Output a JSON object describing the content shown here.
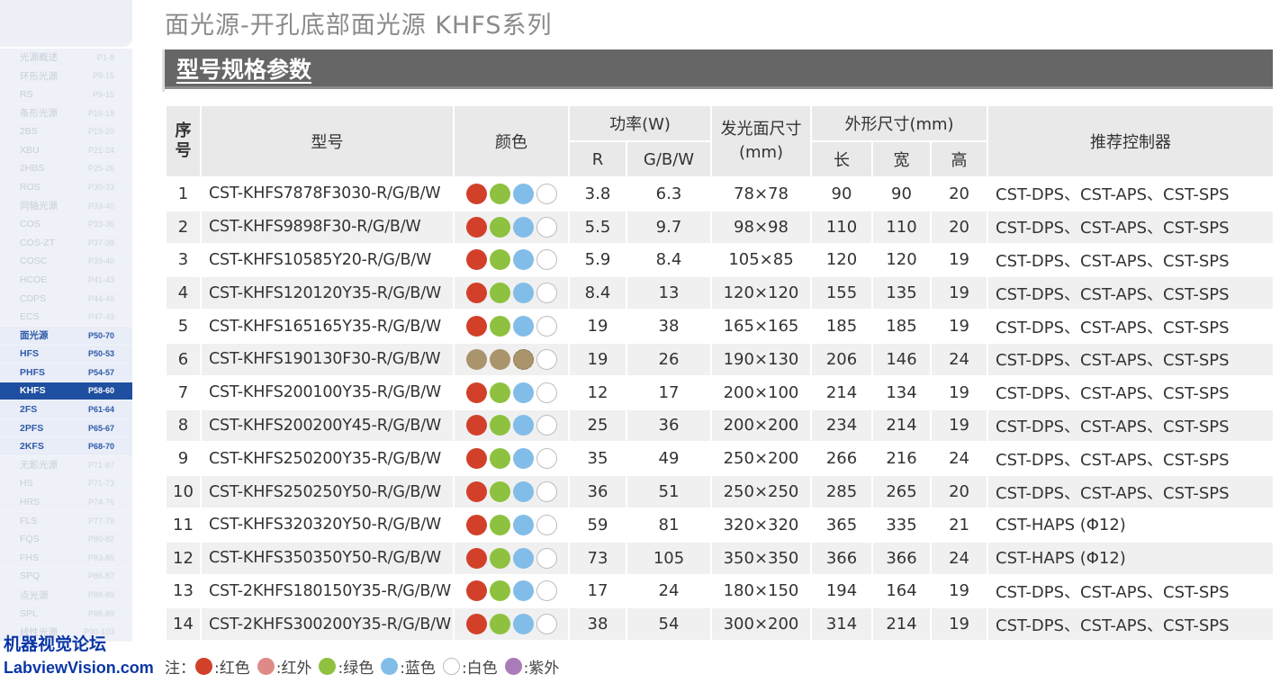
{
  "sidebar": {
    "items": [
      {
        "label": "光源概述",
        "page": "P1-8",
        "state": "faded"
      },
      {
        "label": "环形光源",
        "page": "P9-15",
        "state": "faded"
      },
      {
        "label": "RS",
        "page": "P9-15",
        "state": "faded"
      },
      {
        "label": "条形光源",
        "page": "P16-18",
        "state": "faded"
      },
      {
        "label": "2BS",
        "page": "P19-20",
        "state": "faded"
      },
      {
        "label": "XBU",
        "page": "P21-24",
        "state": "faded"
      },
      {
        "label": "2HBS",
        "page": "P25-26",
        "state": "faded"
      },
      {
        "label": "ROS",
        "page": "P30-33",
        "state": "faded"
      },
      {
        "label": "同轴光源",
        "page": "P33-40",
        "state": "faded"
      },
      {
        "label": "COS",
        "page": "P33-36",
        "state": "faded"
      },
      {
        "label": "COS-ZT",
        "page": "P37-38",
        "state": "faded"
      },
      {
        "label": "COSC",
        "page": "P39-40",
        "state": "faded"
      },
      {
        "label": "HCOE",
        "page": "P41-43",
        "state": "faded"
      },
      {
        "label": "CDPS",
        "page": "P44-46",
        "state": "faded"
      },
      {
        "label": "ECS",
        "page": "P47-49",
        "state": "faded"
      },
      {
        "label": "面光源",
        "page": "P50-70",
        "state": "highlight"
      },
      {
        "label": "HFS",
        "page": "P50-53",
        "state": "highlight"
      },
      {
        "label": "PHFS",
        "page": "P54-57",
        "state": "highlight"
      },
      {
        "label": "KHFS",
        "page": "P58-60",
        "state": "active"
      },
      {
        "label": "2FS",
        "page": "P61-64",
        "state": "highlight"
      },
      {
        "label": "2PFS",
        "page": "P65-67",
        "state": "highlight"
      },
      {
        "label": "2KFS",
        "page": "P68-70",
        "state": "highlight"
      },
      {
        "label": "无影光源",
        "page": "P71-87",
        "state": "faded"
      },
      {
        "label": "HS",
        "page": "P71-73",
        "state": "faded"
      },
      {
        "label": "HRS",
        "page": "P74-76",
        "state": "faded"
      },
      {
        "label": "FLS",
        "page": "P77-79",
        "state": "faded"
      },
      {
        "label": "FQS",
        "page": "P80-82",
        "state": "faded"
      },
      {
        "label": "FHS",
        "page": "P83-85",
        "state": "faded"
      },
      {
        "label": "SPQ",
        "page": "P86-87",
        "state": "faded"
      },
      {
        "label": "点光源",
        "page": "P88-89",
        "state": "faded"
      },
      {
        "label": "SPL",
        "page": "P88-89",
        "state": "faded"
      },
      {
        "label": "线性光源",
        "page": "P90-103",
        "state": "faded"
      }
    ]
  },
  "watermark": {
    "line1": "机器视觉论坛",
    "line2": "LabviewVision.com"
  },
  "page_title": "面光源-开孔底部面光源 KHFS系列",
  "section_title": "型号规格参数",
  "table": {
    "headers": {
      "index": "序号",
      "model": "型号",
      "color": "颜色",
      "power": "功率(W)",
      "power_r": "R",
      "power_gbw": "G/B/W",
      "emit_size": "发光面尺寸(mm)",
      "outline": "外形尺寸(mm)",
      "length": "长",
      "width": "宽",
      "height": "高",
      "controller": "推荐控制器"
    },
    "rows": [
      {
        "no": "1",
        "model": "CST-KHFS7878F3030-R/G/B/W",
        "dots": [
          "red",
          "green",
          "blue",
          "white"
        ],
        "r": "3.8",
        "gbw": "6.3",
        "emit": "78×78",
        "l": "90",
        "w": "90",
        "h": "20",
        "ctrl": "CST-DPS、CST-APS、CST-SPS"
      },
      {
        "no": "2",
        "model": "CST-KHFS9898F30-R/G/B/W",
        "dots": [
          "red",
          "green",
          "blue",
          "white"
        ],
        "r": "5.5",
        "gbw": "9.7",
        "emit": "98×98",
        "l": "110",
        "w": "110",
        "h": "20",
        "ctrl": "CST-DPS、CST-APS、CST-SPS"
      },
      {
        "no": "3",
        "model": "CST-KHFS10585Y20-R/G/B/W",
        "dots": [
          "red",
          "green",
          "blue",
          "white"
        ],
        "r": "5.9",
        "gbw": "8.4",
        "emit": "105×85",
        "l": "120",
        "w": "120",
        "h": "19",
        "ctrl": "CST-DPS、CST-APS、CST-SPS"
      },
      {
        "no": "4",
        "model": "CST-KHFS120120Y35-R/G/B/W",
        "dots": [
          "red",
          "green",
          "blue",
          "white"
        ],
        "r": "8.4",
        "gbw": "13",
        "emit": "120×120",
        "l": "155",
        "w": "135",
        "h": "19",
        "ctrl": "CST-DPS、CST-APS、CST-SPS"
      },
      {
        "no": "5",
        "model": "CST-KHFS165165Y35-R/G/B/W",
        "dots": [
          "red",
          "green",
          "blue",
          "white"
        ],
        "r": "19",
        "gbw": "38",
        "emit": "165×165",
        "l": "185",
        "w": "185",
        "h": "19",
        "ctrl": "CST-DPS、CST-APS、CST-SPS"
      },
      {
        "no": "6",
        "model": "CST-KHFS190130F30-R/G/B/W",
        "dots": [
          "tan",
          "tan",
          "tan-dash",
          "white"
        ],
        "r": "19",
        "gbw": "26",
        "emit": "190×130",
        "l": "206",
        "w": "146",
        "h": "24",
        "ctrl": "CST-DPS、CST-APS、CST-SPS"
      },
      {
        "no": "7",
        "model": "CST-KHFS200100Y35-R/G/B/W",
        "dots": [
          "red",
          "green",
          "blue",
          "white"
        ],
        "r": "12",
        "gbw": "17",
        "emit": "200×100",
        "l": "214",
        "w": "134",
        "h": "19",
        "ctrl": "CST-DPS、CST-APS、CST-SPS"
      },
      {
        "no": "8",
        "model": "CST-KHFS200200Y45-R/G/B/W",
        "dots": [
          "red",
          "green",
          "blue",
          "white"
        ],
        "r": "25",
        "gbw": "36",
        "emit": "200×200",
        "l": "234",
        "w": "214",
        "h": "19",
        "ctrl": "CST-DPS、CST-APS、CST-SPS"
      },
      {
        "no": "9",
        "model": "CST-KHFS250200Y35-R/G/B/W",
        "dots": [
          "red",
          "green",
          "blue",
          "white"
        ],
        "r": "35",
        "gbw": "49",
        "emit": "250×200",
        "l": "266",
        "w": "216",
        "h": "24",
        "ctrl": "CST-DPS、CST-APS、CST-SPS"
      },
      {
        "no": "10",
        "model": "CST-KHFS250250Y50-R/G/B/W",
        "dots": [
          "red",
          "green",
          "blue",
          "white"
        ],
        "r": "36",
        "gbw": "51",
        "emit": "250×250",
        "l": "285",
        "w": "265",
        "h": "20",
        "ctrl": "CST-DPS、CST-APS、CST-SPS"
      },
      {
        "no": "11",
        "model": "CST-KHFS320320Y50-R/G/B/W",
        "dots": [
          "red",
          "green",
          "blue",
          "white"
        ],
        "r": "59",
        "gbw": "81",
        "emit": "320×320",
        "l": "365",
        "w": "335",
        "h": "21",
        "ctrl": "CST-HAPS (Φ12)"
      },
      {
        "no": "12",
        "model": "CST-KHFS350350Y50-R/G/B/W",
        "dots": [
          "red",
          "green",
          "blue",
          "white"
        ],
        "r": "73",
        "gbw": "105",
        "emit": "350×350",
        "l": "366",
        "w": "366",
        "h": "24",
        "ctrl": "CST-HAPS (Φ12)"
      },
      {
        "no": "13",
        "model": "CST-2KHFS180150Y35-R/G/B/W",
        "dots": [
          "red",
          "green",
          "blue",
          "white"
        ],
        "r": "17",
        "gbw": "24",
        "emit": "180×150",
        "l": "194",
        "w": "164",
        "h": "19",
        "ctrl": "CST-DPS、CST-APS、CST-SPS"
      },
      {
        "no": "14",
        "model": "CST-2KHFS300200Y35-R/G/B/W",
        "dots": [
          "red",
          "green",
          "blue",
          "white"
        ],
        "r": "38",
        "gbw": "54",
        "emit": "300×200",
        "l": "314",
        "w": "214",
        "h": "19",
        "ctrl": "CST-DPS、CST-APS、CST-SPS"
      }
    ]
  },
  "legend": {
    "prefix": "注：",
    "items": [
      {
        "label": ":红色",
        "color": "#d2402a"
      },
      {
        "label": ":红外",
        "color": "#df8a86"
      },
      {
        "label": ":绿色",
        "color": "#8dc13f"
      },
      {
        "label": ":蓝色",
        "color": "#82bde9"
      },
      {
        "label": ":白色",
        "color": "#ffffff"
      },
      {
        "label": ":紫外",
        "color": "#a97bb8"
      }
    ]
  },
  "colors": {
    "section_bar": "#666666",
    "header_bg": "#e9e9e9",
    "sidebar_active": "#1f4fa0",
    "watermark": "#0b36a6"
  }
}
